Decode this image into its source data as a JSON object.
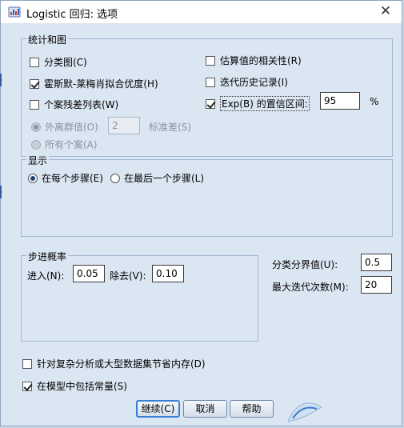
{
  "window": {
    "title": "Logistic 回归: 选项",
    "close_glyph": "✕"
  },
  "stats_group": {
    "legend": "统计和图",
    "classification_plots": {
      "label": "分类图(C)",
      "checked": false
    },
    "hosmer_lemeshow": {
      "label": "霍斯默-莱梅肖拟合优度(H)",
      "checked": true
    },
    "casewise_listing": {
      "label": "个案残差列表(W)",
      "checked": false
    },
    "outliers_outside": {
      "label": "外离群值(O)",
      "selected": true,
      "disabled": true
    },
    "sd_value": "2",
    "sd_label": "标准差(S)",
    "all_cases": {
      "label": "所有个案(A)",
      "selected": false,
      "disabled": true
    },
    "correlations": {
      "label": "估算值的相关性(R)",
      "checked": false
    },
    "iteration_history": {
      "label": "迭代历史记录(I)",
      "checked": false
    },
    "ci_expb": {
      "label": "Exp(B) 的置信区间:",
      "checked": true
    },
    "ci_value": "95",
    "ci_unit": "%"
  },
  "display_group": {
    "legend": "显示",
    "each_step": {
      "label": "在每个步骤(E)",
      "selected": true
    },
    "last_step": {
      "label": "在最后一个步骤(L)",
      "selected": false
    }
  },
  "stepwise_group": {
    "legend": "步进概率",
    "entry_label": "进入(N):",
    "entry_value": "0.05",
    "removal_label": "除去(V):",
    "removal_value": "0.10"
  },
  "classification_cutoff": {
    "label": "分类分界值(U):",
    "value": "0.5"
  },
  "max_iterations": {
    "label": "最大迭代次数(M):",
    "value": "20"
  },
  "conserve_memory": {
    "label": "针对复杂分析或大型数据集节省内存(D)",
    "checked": false
  },
  "include_constant": {
    "label": "在模型中包括常量(S)",
    "checked": true
  },
  "buttons": {
    "continue": "继续(C)",
    "cancel": "取消",
    "help": "帮助"
  },
  "colors": {
    "dialog_bg": "#dbe6f3",
    "group_border": "#9fb6d3",
    "default_button_border": "#3c7fd6"
  }
}
